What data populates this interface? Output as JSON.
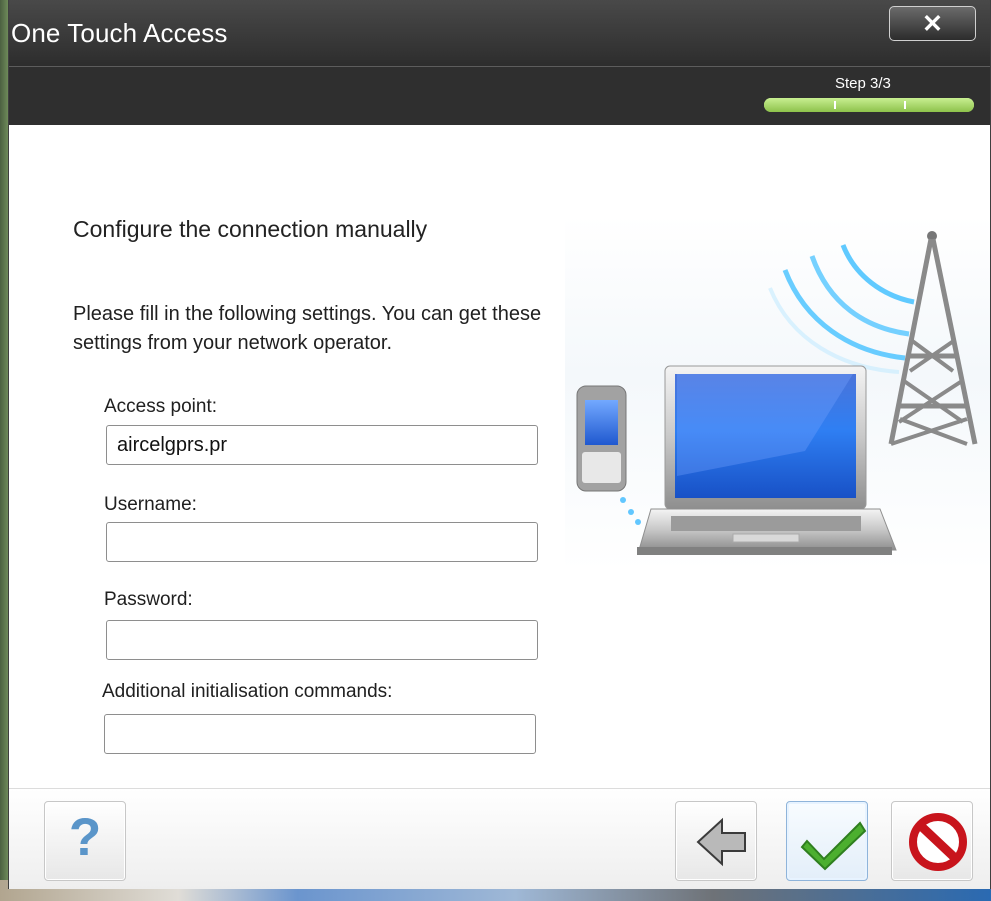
{
  "window": {
    "title": "One Touch Access",
    "close_symbol": "✕"
  },
  "wizard": {
    "step_label": "Step 3/3",
    "progress": 1.0
  },
  "content": {
    "heading": "Configure the connection manually",
    "instructions": "Please fill in the following settings. You can get these settings from your network operator.",
    "fields": {
      "access_point": {
        "label": "Access point:",
        "value": "aircelgprs.pr"
      },
      "username": {
        "label": "Username:",
        "value": ""
      },
      "password": {
        "label": "Password:",
        "value": ""
      },
      "additional_commands": {
        "label": "Additional initialisation commands:",
        "value": ""
      }
    }
  },
  "buttons": {
    "help_symbol": "?",
    "help_icon": "help-icon",
    "back_icon": "back-arrow-icon",
    "confirm_icon": "check-icon",
    "cancel_icon": "cancel-icon"
  },
  "colors": {
    "progress_green": "#8ec24b",
    "help_blue": "#5a95c9",
    "confirm_green": "#4caf2f",
    "cancel_red": "#c8141c"
  }
}
